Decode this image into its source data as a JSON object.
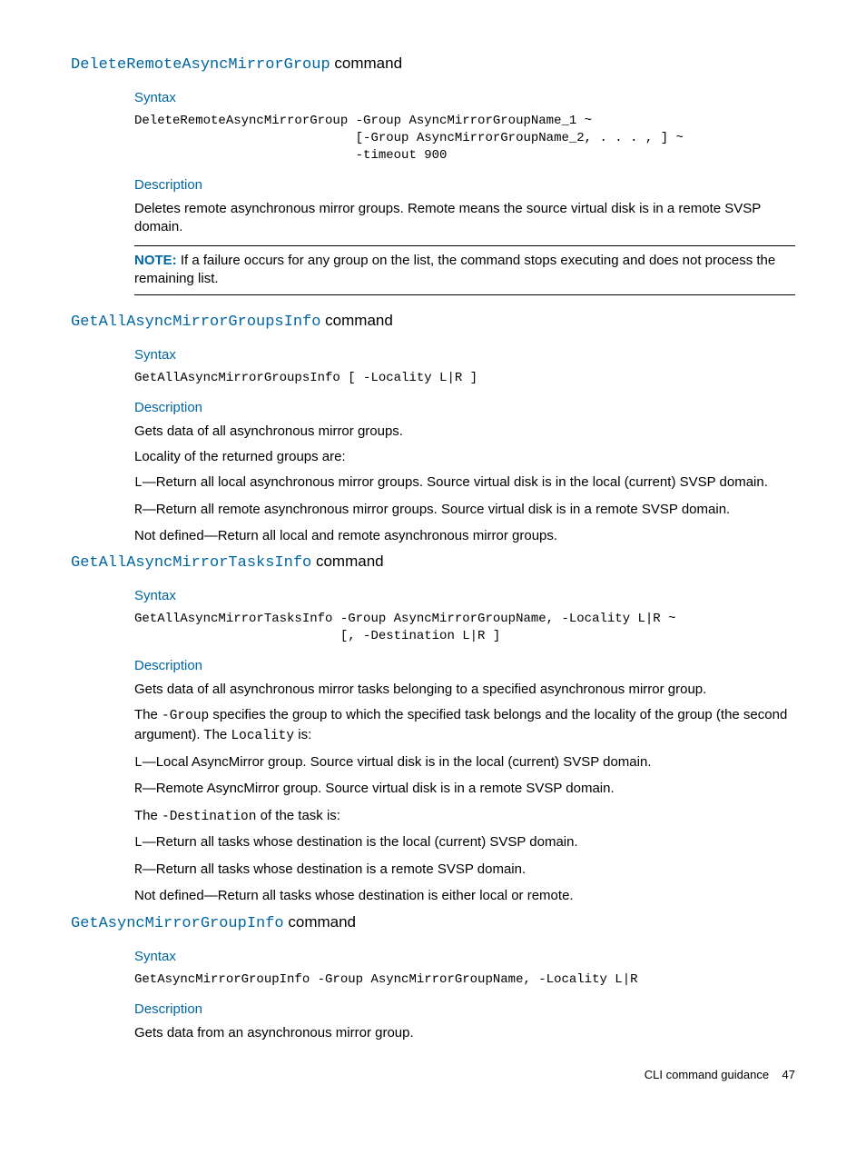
{
  "section1": {
    "title_code": "DeleteRemoteAsyncMirrorGroup",
    "title_plain": " command",
    "syntax_label": "Syntax",
    "syntax_code": "DeleteRemoteAsyncMirrorGroup -Group AsyncMirrorGroupName_1 ~\n                             [-Group AsyncMirrorGroupName_2, . . . , ] ~\n                             -timeout 900",
    "desc_label": "Description",
    "desc_text": "Deletes remote asynchronous mirror groups. Remote means the source virtual disk is in a remote SVSP domain.",
    "note_label": "NOTE:",
    "note_text": "   If a failure occurs for any group on the list, the command stops executing and does not process the remaining list."
  },
  "section2": {
    "title_code": "GetAllAsyncMirrorGroupsInfo",
    "title_plain": " command",
    "syntax_label": "Syntax",
    "syntax_code": "GetAllAsyncMirrorGroupsInfo [ -Locality L|R ]",
    "desc_label": "Description",
    "p1": "Gets data of all asynchronous mirror groups.",
    "p2": "Locality of the returned groups are:",
    "l_code": "L",
    "l_text": "—Return all local asynchronous mirror groups. Source virtual disk is in the local (current) SVSP domain.",
    "r_code": "R",
    "r_text": "—Return all remote asynchronous mirror groups. Source virtual disk is in a remote SVSP domain.",
    "nd": "Not defined—Return all local and remote asynchronous mirror groups."
  },
  "section3": {
    "title_code": "GetAllAsyncMirrorTasksInfo",
    "title_plain": " command",
    "syntax_label": "Syntax",
    "syntax_code": "GetAllAsyncMirrorTasksInfo -Group AsyncMirrorGroupName, -Locality L|R ~\n                           [, -Destination L|R ]",
    "desc_label": "Description",
    "p1": "Gets data of all asynchronous mirror tasks belonging to a specified asynchronous mirror group.",
    "g_pre": "The ",
    "g_code": "-Group",
    "g_mid": " specifies the group to which the specified task belongs and the locality of the group (the second argument). The ",
    "g_loc": "Locality",
    "g_post": " is:",
    "l_code": "L",
    "l_text": "—Local AsyncMirror group. Source virtual disk is in the local (current) SVSP domain.",
    "r_code": "R",
    "r_text": "—Remote AsyncMirror group. Source virtual disk is in a remote SVSP domain.",
    "d_pre": "The ",
    "d_code": "-Destination",
    "d_post": " of the task is:",
    "dl_code": "L",
    "dl_text": "—Return all tasks whose destination is the local (current) SVSP domain.",
    "dr_code": "R",
    "dr_text": "—Return all tasks whose destination is a remote SVSP domain.",
    "nd": "Not defined—Return all tasks whose destination is either local or remote."
  },
  "section4": {
    "title_code": "GetAsyncMirrorGroupInfo",
    "title_plain": " command",
    "syntax_label": "Syntax",
    "syntax_code": "GetAsyncMirrorGroupInfo -Group AsyncMirrorGroupName, -Locality L|R",
    "desc_label": "Description",
    "p1": "Gets data from an asynchronous mirror group."
  },
  "footer": {
    "text": "CLI command guidance",
    "page": "47"
  }
}
